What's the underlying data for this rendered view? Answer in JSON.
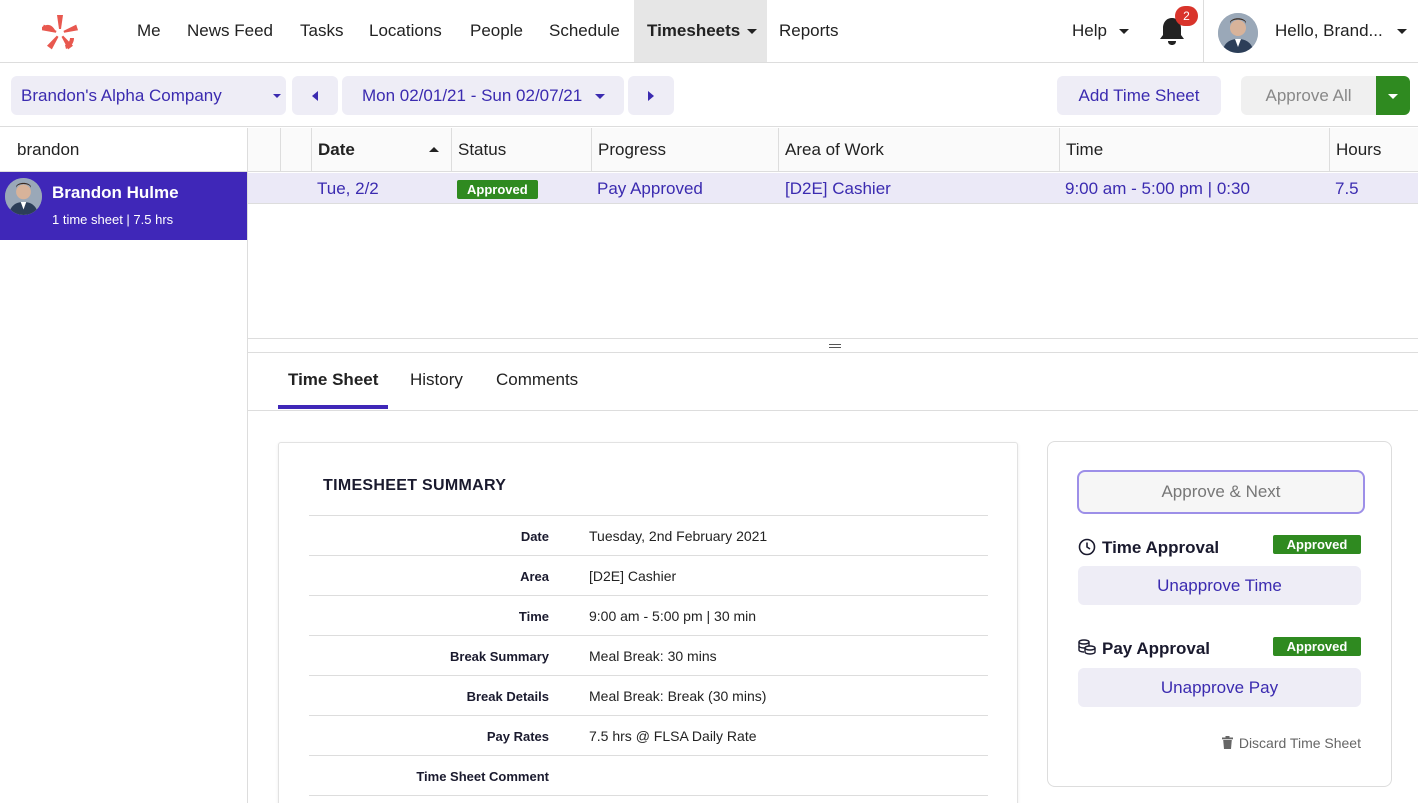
{
  "nav": {
    "items": [
      "Me",
      "News Feed",
      "Tasks",
      "Locations",
      "People",
      "Schedule",
      "Timesheets",
      "Reports"
    ],
    "help": "Help",
    "notifications": "2",
    "greeting": "Hello, Brand..."
  },
  "toolbar": {
    "company": "Brandon's Alpha Company",
    "date_range": "Mon 02/01/21 - Sun 02/07/21",
    "add_time_sheet": "Add Time Sheet",
    "approve_all": "Approve All"
  },
  "search": {
    "value": "brandon"
  },
  "person": {
    "name": "Brandon Hulme",
    "meta": "1 time sheet | 7.5 hrs"
  },
  "table": {
    "headers": [
      "Date",
      "Status",
      "Progress",
      "Area of Work",
      "Time",
      "Hours"
    ],
    "rows": [
      {
        "date": "Tue, 2/2",
        "status": "Approved",
        "progress": "Pay Approved",
        "area": "[D2E] Cashier",
        "time": "9:00 am - 5:00 pm | 0:30",
        "hours": "7.5"
      }
    ]
  },
  "tabs": [
    "Time Sheet",
    "History",
    "Comments"
  ],
  "summary": {
    "title": "TIMESHEET SUMMARY",
    "rows": [
      {
        "label": "Date",
        "value": "Tuesday, 2nd February 2021"
      },
      {
        "label": "Area",
        "value": "[D2E] Cashier"
      },
      {
        "label": "Time",
        "value": "9:00 am - 5:00 pm | 30 min"
      },
      {
        "label": "Break Summary",
        "value": "Meal Break: 30 mins"
      },
      {
        "label": "Break Details",
        "value": "Meal Break: Break (30 mins)"
      },
      {
        "label": "Pay Rates",
        "value": "7.5 hrs @ FLSA Daily Rate"
      },
      {
        "label": "Time Sheet Comment",
        "value": ""
      }
    ]
  },
  "approval": {
    "approve_next": "Approve & Next",
    "time_title": "Time Approval",
    "time_status": "Approved",
    "unapprove_time": "Unapprove Time",
    "pay_title": "Pay Approval",
    "pay_status": "Approved",
    "unapprove_pay": "Unapprove Pay",
    "discard": "Discard Time Sheet"
  },
  "colors": {
    "accent": "#3f27b8",
    "approved": "#2f8a20",
    "badge": "#d9342b",
    "logo": "#e8584f"
  }
}
